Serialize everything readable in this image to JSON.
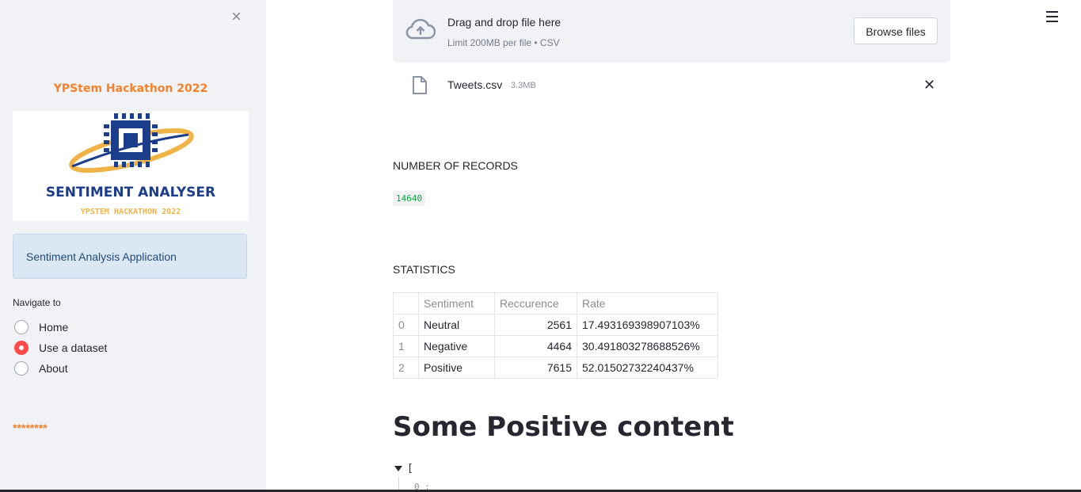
{
  "sidebar": {
    "close_icon": "×",
    "title": "YPStem Hackathon 2022",
    "logo": {
      "caption": "SENTIMENT ANALYSER",
      "subcaption": "YPSTEM HACKATHON 2022"
    },
    "info": "Sentiment Analysis Application",
    "nav_label": "Navigate to",
    "nav_options": [
      {
        "label": "Home",
        "selected": false
      },
      {
        "label": "Use a dataset",
        "selected": true
      },
      {
        "label": "About",
        "selected": false
      }
    ],
    "stars": "********"
  },
  "uploader": {
    "title": "Drag and drop file here",
    "subtitle": "Limit 200MB per file • CSV",
    "browse_label": "Browse files",
    "file_name": "Tweets.csv",
    "file_size": "3.3MB",
    "remove_icon": "✕"
  },
  "records": {
    "label": "NUMBER OF RECORDS",
    "value": "14640"
  },
  "statistics": {
    "label": "STATISTICS",
    "columns": [
      "",
      "Sentiment",
      "Reccurence",
      "Rate"
    ],
    "rows": [
      [
        "0",
        "Neutral",
        "2561",
        "17.493169398907103%"
      ],
      [
        "1",
        "Negative",
        "4464",
        "30.491803278688526%"
      ],
      [
        "2",
        "Positive",
        "7615",
        "52.01502732240437%"
      ]
    ]
  },
  "heading": "Some Positive content",
  "json_view": {
    "open_bracket": "[",
    "first_key": "0 :"
  },
  "colors": {
    "accent": "#ff4b4b",
    "sidebar_bg": "#f0f2f6",
    "orange": "#f5812b",
    "green_code": "#09ab3b"
  }
}
